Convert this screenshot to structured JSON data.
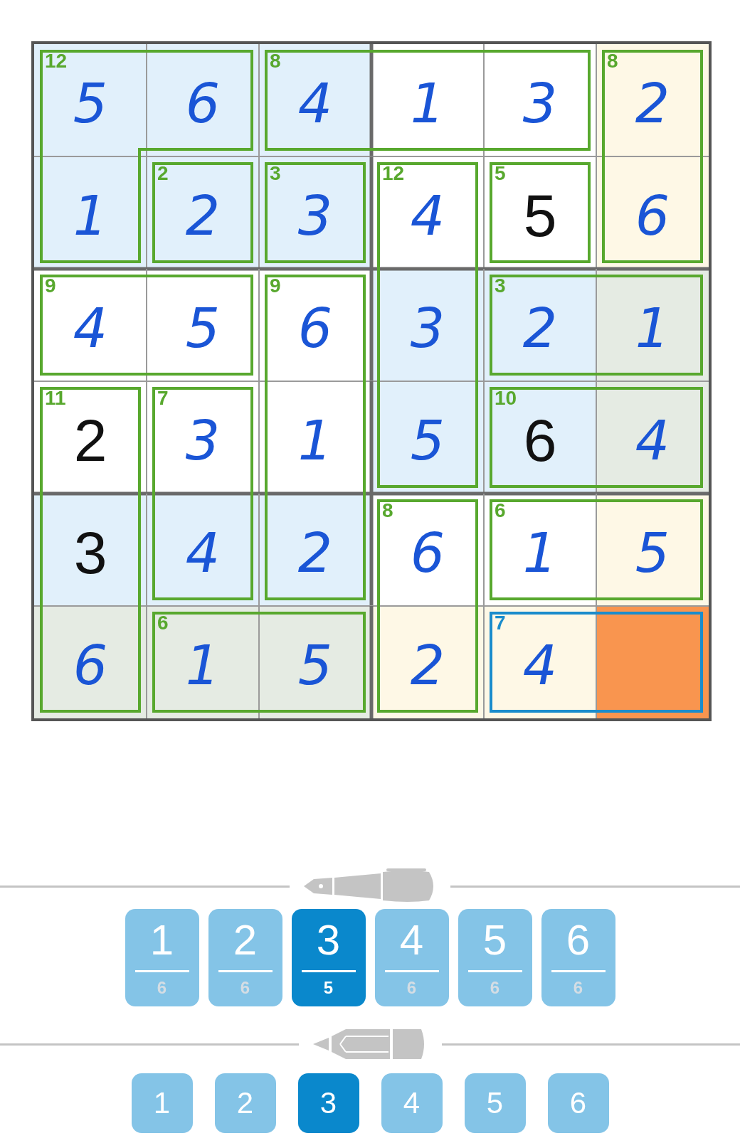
{
  "grid": {
    "rows": [
      {
        "cells": [
          {
            "value": "5",
            "kind": "entry",
            "color": "#e1f0fb",
            "cage": {
              "sum": "12",
              "selected": false,
              "right": false,
              "bottom": false
            }
          },
          {
            "value": "6",
            "kind": "entry",
            "color": "#e1f0fb",
            "cage": {
              "right": true,
              "bottom": true
            }
          },
          {
            "value": "4",
            "kind": "entry",
            "color": "#e1f0fb",
            "cage": {
              "sum": "8",
              "selected": false,
              "right": false,
              "bottom": true
            }
          },
          {
            "value": "1",
            "kind": "entry",
            "color": "#ffffff",
            "cage": {
              "right": false,
              "bottom": true
            }
          },
          {
            "value": "3",
            "kind": "entry",
            "color": "#ffffff",
            "cage": {
              "right": true,
              "bottom": true
            }
          },
          {
            "value": "2",
            "kind": "entry",
            "color": "#fef8e6",
            "cage": {
              "sum": "8",
              "selected": false,
              "bottom": false
            }
          }
        ]
      },
      {
        "cells": [
          {
            "value": "1",
            "kind": "entry",
            "color": "#e1f0fb",
            "cage": {
              "right": true,
              "bottom": true
            }
          },
          {
            "value": "2",
            "kind": "entry",
            "color": "#e1f0fb",
            "cage": {
              "sum": "2",
              "selected": false,
              "right": true,
              "bottom": true
            }
          },
          {
            "value": "3",
            "kind": "entry",
            "color": "#e1f0fb",
            "cage": {
              "sum": "3",
              "selected": false,
              "right": true,
              "bottom": true
            }
          },
          {
            "value": "4",
            "kind": "entry",
            "color": "#ffffff",
            "cage": {
              "sum": "12",
              "selected": false,
              "right": true,
              "bottom": false
            }
          },
          {
            "value": "5",
            "kind": "given",
            "color": "#ffffff",
            "cage": {
              "sum": "5",
              "selected": false,
              "right": true,
              "bottom": true
            }
          },
          {
            "value": "6",
            "kind": "entry",
            "color": "#fef8e6",
            "cage": {
              "bottom": true
            }
          }
        ]
      },
      {
        "cells": [
          {
            "value": "4",
            "kind": "entry",
            "color": "#ffffff",
            "cage": {
              "sum": "9",
              "selected": false,
              "right": false,
              "bottom": true
            }
          },
          {
            "value": "5",
            "kind": "entry",
            "color": "#ffffff",
            "cage": {
              "right": true,
              "bottom": true
            }
          },
          {
            "value": "6",
            "kind": "entry",
            "color": "#ffffff",
            "cage": {
              "sum": "9",
              "selected": false,
              "right": true,
              "bottom": false
            }
          },
          {
            "value": "3",
            "kind": "entry",
            "color": "#e1f0fb",
            "cage": {
              "right": true,
              "bottom": false
            }
          },
          {
            "value": "2",
            "kind": "entry",
            "color": "#e1f0fb",
            "cage": {
              "sum": "3",
              "selected": false,
              "right": false,
              "bottom": true
            }
          },
          {
            "value": "1",
            "kind": "entry",
            "color": "#e5ebe3",
            "cage": {
              "bottom": true
            }
          }
        ]
      },
      {
        "cells": [
          {
            "value": "2",
            "kind": "given",
            "color": "#ffffff",
            "cage": {
              "sum": "11",
              "selected": false,
              "right": true,
              "bottom": false
            }
          },
          {
            "value": "3",
            "kind": "entry",
            "color": "#ffffff",
            "cage": {
              "sum": "7",
              "selected": false,
              "right": true,
              "bottom": false
            }
          },
          {
            "value": "1",
            "kind": "entry",
            "color": "#ffffff",
            "cage": {
              "right": true,
              "bottom": false
            }
          },
          {
            "value": "5",
            "kind": "entry",
            "color": "#e1f0fb",
            "cage": {
              "right": true,
              "bottom": true
            }
          },
          {
            "value": "6",
            "kind": "given",
            "color": "#e1f0fb",
            "cage": {
              "sum": "10",
              "selected": false,
              "right": false,
              "bottom": true
            }
          },
          {
            "value": "4",
            "kind": "entry",
            "color": "#e5ebe3",
            "cage": {
              "bottom": true
            }
          }
        ]
      },
      {
        "cells": [
          {
            "value": "3",
            "kind": "given",
            "color": "#e1f0fb",
            "cage": {
              "right": true,
              "bottom": false
            }
          },
          {
            "value": "4",
            "kind": "entry",
            "color": "#e1f0fb",
            "cage": {
              "right": true,
              "bottom": true
            }
          },
          {
            "value": "2",
            "kind": "entry",
            "color": "#e1f0fb",
            "cage": {
              "right": true,
              "bottom": true
            }
          },
          {
            "value": "6",
            "kind": "entry",
            "color": "#ffffff",
            "cage": {
              "sum": "8",
              "selected": false,
              "right": true,
              "bottom": false
            }
          },
          {
            "value": "1",
            "kind": "entry",
            "color": "#ffffff",
            "cage": {
              "sum": "6",
              "selected": false,
              "right": false,
              "bottom": true
            }
          },
          {
            "value": "5",
            "kind": "entry",
            "color": "#fef8e6",
            "cage": {
              "bottom": true
            }
          }
        ]
      },
      {
        "cells": [
          {
            "value": "6",
            "kind": "entry",
            "color": "#e5ebe3",
            "cage": {
              "right": true
            }
          },
          {
            "value": "1",
            "kind": "entry",
            "color": "#e5ebe3",
            "cage": {
              "sum": "6",
              "selected": false,
              "right": false
            }
          },
          {
            "value": "5",
            "kind": "entry",
            "color": "#e5ebe3",
            "cage": {
              "right": true
            }
          },
          {
            "value": "2",
            "kind": "entry",
            "color": "#fef8e6",
            "cage": {
              "right": true
            }
          },
          {
            "value": "4",
            "kind": "entry",
            "color": "#fef8e6",
            "cage": {
              "sum": "7",
              "selected": true,
              "right": false
            }
          },
          {
            "kind": "empty",
            "color": "#f9954f"
          }
        ]
      }
    ]
  },
  "pen_buttons": [
    {
      "digit": "1",
      "count": "6",
      "selected": false
    },
    {
      "digit": "2",
      "count": "6",
      "selected": false
    },
    {
      "digit": "3",
      "count": "5",
      "selected": true
    },
    {
      "digit": "4",
      "count": "6",
      "selected": false
    },
    {
      "digit": "5",
      "count": "6",
      "selected": false
    },
    {
      "digit": "6",
      "count": "6",
      "selected": false
    }
  ],
  "pencil_buttons": [
    {
      "digit": "1",
      "selected": false
    },
    {
      "digit": "2",
      "selected": false
    },
    {
      "digit": "3",
      "selected": true
    },
    {
      "digit": "4",
      "selected": false
    },
    {
      "digit": "5",
      "selected": false
    },
    {
      "digit": "6",
      "selected": false
    }
  ]
}
